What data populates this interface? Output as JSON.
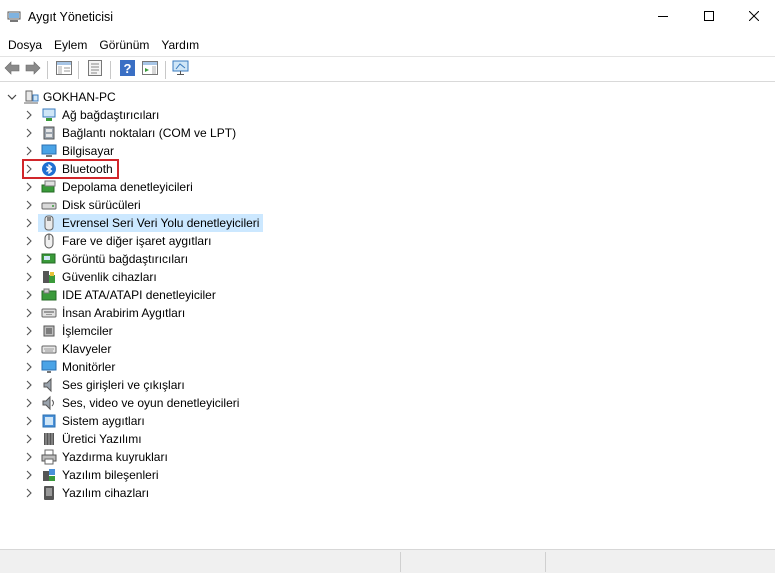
{
  "window": {
    "title": "Aygıt Yöneticisi"
  },
  "menu": [
    "Dosya",
    "Eylem",
    "Görünüm",
    "Yardım"
  ],
  "toolbar": [
    "back-arrow-icon",
    "forward-arrow-icon",
    "show-hide-tree-icon",
    "properties-icon",
    "help-icon",
    "action-pane-icon",
    "monitor-icon"
  ],
  "tree": {
    "root": {
      "label": "GOKHAN-PC",
      "icon": "computer-icon"
    },
    "highlighted_label": "Bluetooth",
    "selected_label": "Evrensel Seri Veri Yolu denetleyicileri",
    "items": [
      {
        "label": "Ağ bağdaştırıcıları",
        "icon": "network-adapter-icon"
      },
      {
        "label": "Bağlantı noktaları (COM ve LPT)",
        "icon": "port-icon"
      },
      {
        "label": "Bilgisayar",
        "icon": "computer-icon"
      },
      {
        "label": "Bluetooth",
        "icon": "bluetooth-icon"
      },
      {
        "label": "Depolama denetleyicileri",
        "icon": "storage-controller-icon"
      },
      {
        "label": "Disk sürücüleri",
        "icon": "disk-drive-icon"
      },
      {
        "label": "Evrensel Seri Veri Yolu denetleyicileri",
        "icon": "usb-icon"
      },
      {
        "label": "Fare ve diğer işaret aygıtları",
        "icon": "mouse-icon"
      },
      {
        "label": "Görüntü bağdaştırıcıları",
        "icon": "display-adapter-icon"
      },
      {
        "label": "Güvenlik cihazları",
        "icon": "security-device-icon"
      },
      {
        "label": "IDE ATA/ATAPI denetleyiciler",
        "icon": "ide-controller-icon"
      },
      {
        "label": "İnsan Arabirim Aygıtları",
        "icon": "hid-icon"
      },
      {
        "label": "İşlemciler",
        "icon": "processor-icon"
      },
      {
        "label": "Klavyeler",
        "icon": "keyboard-icon"
      },
      {
        "label": "Monitörler",
        "icon": "monitor-icon"
      },
      {
        "label": "Ses girişleri ve çıkışları",
        "icon": "audio-io-icon"
      },
      {
        "label": "Ses, video ve oyun denetleyicileri",
        "icon": "sound-video-icon"
      },
      {
        "label": "Sistem aygıtları",
        "icon": "system-device-icon"
      },
      {
        "label": "Üretici Yazılımı",
        "icon": "firmware-icon"
      },
      {
        "label": "Yazdırma kuyrukları",
        "icon": "printer-icon"
      },
      {
        "label": "Yazılım bileşenleri",
        "icon": "software-component-icon"
      },
      {
        "label": "Yazılım cihazları",
        "icon": "software-device-icon"
      }
    ]
  },
  "colors": {
    "selection": "#cce8ff",
    "highlight_box": "#d1262b"
  }
}
